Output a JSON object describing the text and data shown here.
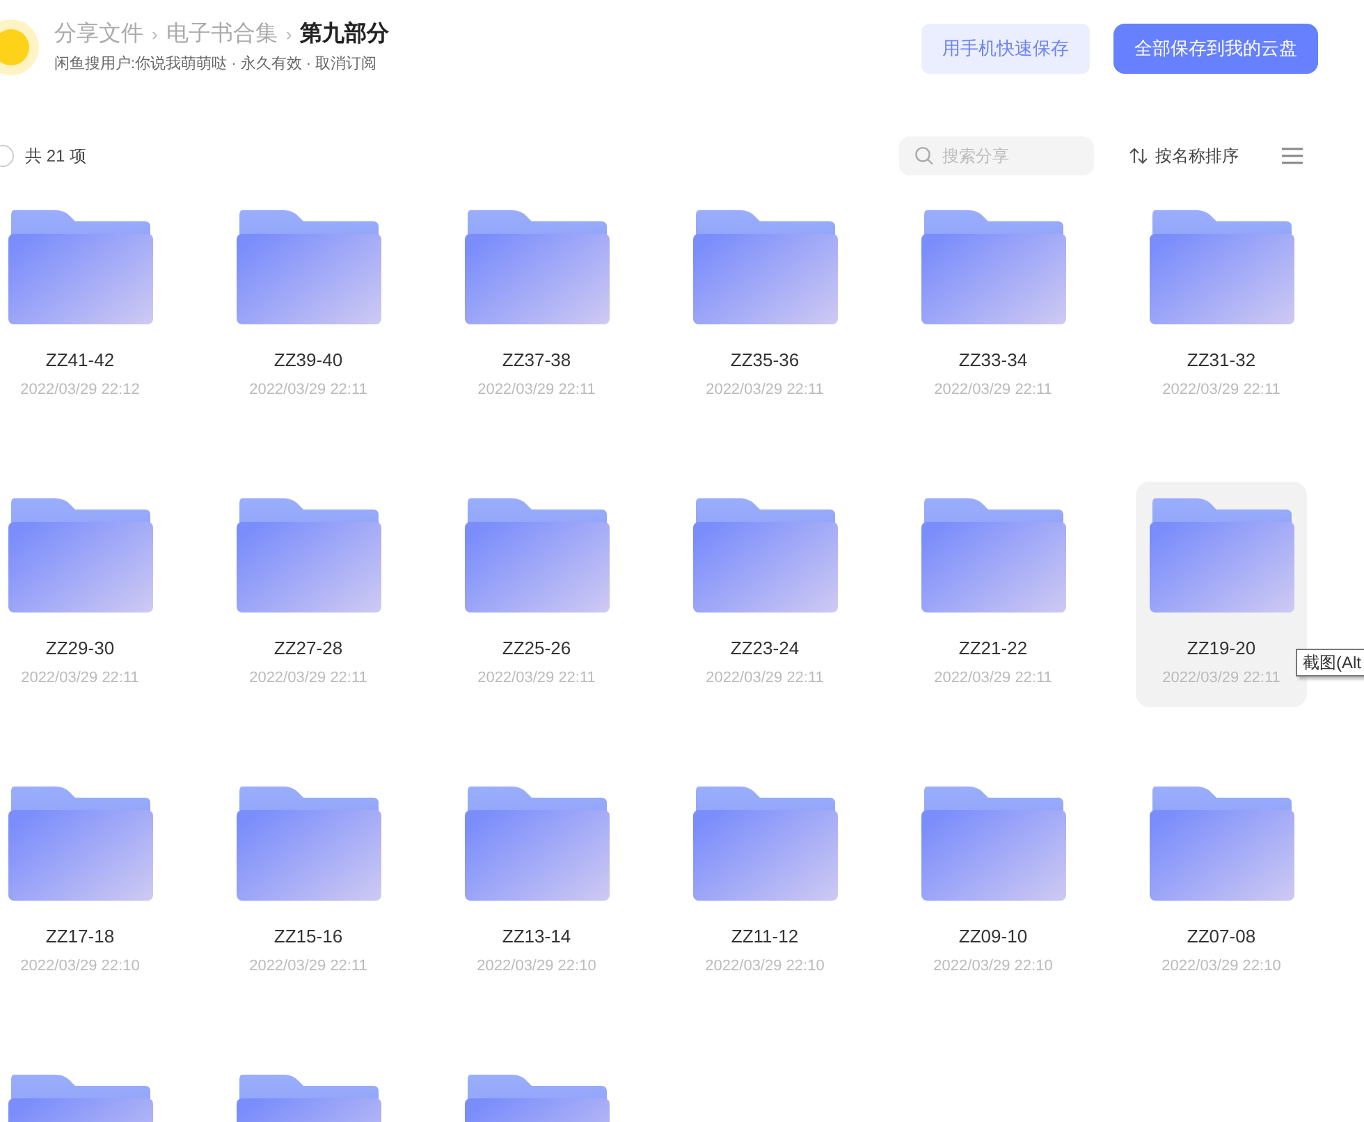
{
  "header": {
    "breadcrumb": [
      {
        "label": "分享文件",
        "current": false
      },
      {
        "label": "电子书合集",
        "current": false
      },
      {
        "label": "第九部分",
        "current": true
      }
    ],
    "separator": "›",
    "subtitle": "闲鱼搜用户:你说我萌萌哒 · 永久有效 · 取消订阅",
    "buttons": [
      {
        "label": "用手机快速保存",
        "kind": "secondary"
      },
      {
        "label": "全部保存到我的云盘",
        "kind": "primary"
      }
    ]
  },
  "toolbar": {
    "select_all": {
      "checked": false
    },
    "count": "共 21 项",
    "search": {
      "placeholder": "搜索分享"
    },
    "sort": "按名称排序"
  },
  "files": [
    {
      "name": "ZZ41-42",
      "date": "2022/03/29 22:12",
      "selected": false
    },
    {
      "name": "ZZ39-40",
      "date": "2022/03/29 22:11",
      "selected": false
    },
    {
      "name": "ZZ37-38",
      "date": "2022/03/29 22:11",
      "selected": false
    },
    {
      "name": "ZZ35-36",
      "date": "2022/03/29 22:11",
      "selected": false
    },
    {
      "name": "ZZ33-34",
      "date": "2022/03/29 22:11",
      "selected": false
    },
    {
      "name": "ZZ31-32",
      "date": "2022/03/29 22:11",
      "selected": false
    },
    {
      "name": "ZZ29-30",
      "date": "2022/03/29 22:11",
      "selected": false
    },
    {
      "name": "ZZ27-28",
      "date": "2022/03/29 22:11",
      "selected": false
    },
    {
      "name": "ZZ25-26",
      "date": "2022/03/29 22:11",
      "selected": false
    },
    {
      "name": "ZZ23-24",
      "date": "2022/03/29 22:11",
      "selected": false
    },
    {
      "name": "ZZ21-22",
      "date": "2022/03/29 22:11",
      "selected": false
    },
    {
      "name": "ZZ19-20",
      "date": "2022/03/29 22:11",
      "selected": true
    },
    {
      "name": "ZZ17-18",
      "date": "2022/03/29 22:10",
      "selected": false
    },
    {
      "name": "ZZ15-16",
      "date": "2022/03/29 22:11",
      "selected": false
    },
    {
      "name": "ZZ13-14",
      "date": "2022/03/29 22:10",
      "selected": false
    },
    {
      "name": "ZZ11-12",
      "date": "2022/03/29 22:10",
      "selected": false
    },
    {
      "name": "ZZ09-10",
      "date": "2022/03/29 22:10",
      "selected": false
    },
    {
      "name": "ZZ07-08",
      "date": "2022/03/29 22:10",
      "selected": false
    },
    {
      "selected": false
    },
    {
      "selected": false
    },
    {
      "selected": false
    }
  ],
  "tooltip": "截图(Alt"
}
